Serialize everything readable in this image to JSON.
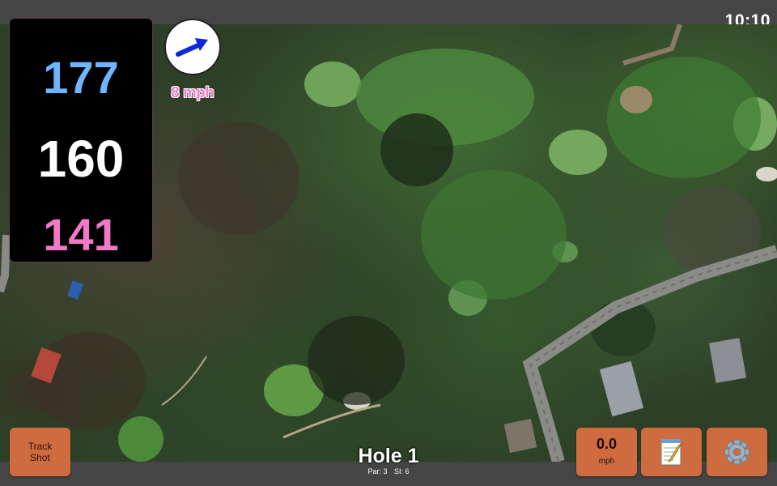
{
  "status": {
    "time": "10:10"
  },
  "distances": {
    "back": "177",
    "middle": "160",
    "front": "141"
  },
  "wind": {
    "speed_label": "8 mph",
    "icon": "wind-arrow-icon"
  },
  "hole": {
    "title": "Hole 1",
    "par": "Par: 3",
    "stroke_index": "SI: 6"
  },
  "buttons": {
    "track_shot_line1": "Track",
    "track_shot_line2": "Shot",
    "speed_value": "0.0",
    "speed_unit": "mph",
    "notes_icon": "notepad-icon",
    "settings_icon": "gear-icon"
  },
  "colors": {
    "back_distance": "#6db6ff",
    "middle_distance": "#ffffff",
    "front_distance": "#f07ac8",
    "button": "#cf6c3f",
    "wind_arrow": "#0a28d8"
  }
}
